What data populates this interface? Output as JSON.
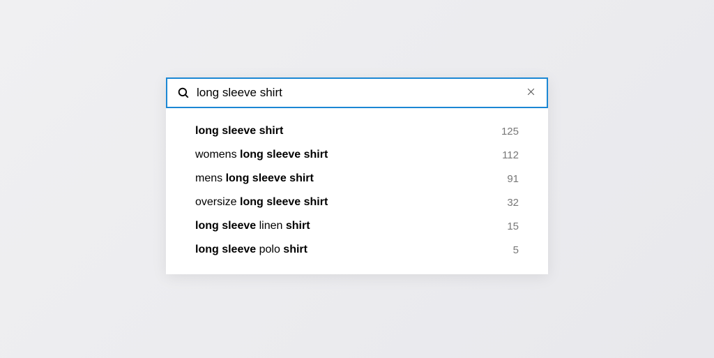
{
  "search": {
    "value": "long sleeve shirt",
    "placeholder": ""
  },
  "suggestions": [
    {
      "segments": [
        {
          "text": "long sleeve shirt",
          "bold": true
        }
      ],
      "count": 125
    },
    {
      "segments": [
        {
          "text": "womens ",
          "bold": false
        },
        {
          "text": "long sleeve shirt",
          "bold": true
        }
      ],
      "count": 112
    },
    {
      "segments": [
        {
          "text": "mens ",
          "bold": false
        },
        {
          "text": "long sleeve shirt",
          "bold": true
        }
      ],
      "count": 91
    },
    {
      "segments": [
        {
          "text": "oversize ",
          "bold": false
        },
        {
          "text": "long sleeve shirt",
          "bold": true
        }
      ],
      "count": 32
    },
    {
      "segments": [
        {
          "text": "long sleeve",
          "bold": true
        },
        {
          "text": " linen ",
          "bold": false
        },
        {
          "text": "shirt",
          "bold": true
        }
      ],
      "count": 15
    },
    {
      "segments": [
        {
          "text": "long sleeve",
          "bold": true
        },
        {
          "text": " polo ",
          "bold": false
        },
        {
          "text": "shirt",
          "bold": true
        }
      ],
      "count": 5
    }
  ]
}
